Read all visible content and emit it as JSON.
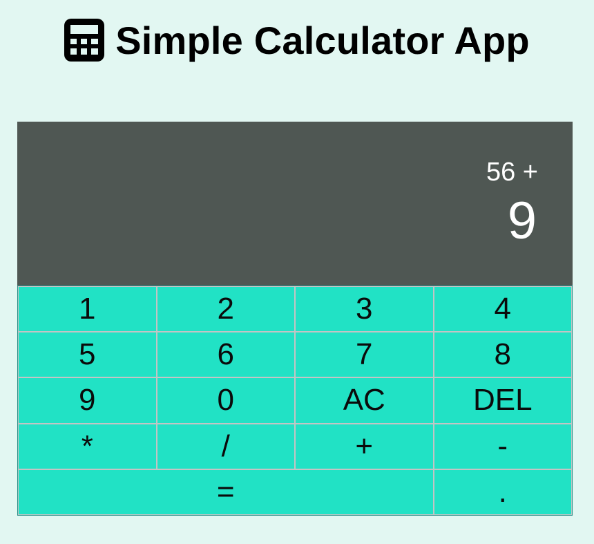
{
  "header": {
    "icon": "calculator-icon",
    "title": "Simple Calculator App"
  },
  "display": {
    "previous": "56 +",
    "current": "9"
  },
  "keypad": {
    "rows": [
      [
        "1",
        "2",
        "3",
        "4"
      ],
      [
        "5",
        "6",
        "7",
        "8"
      ],
      [
        "9",
        "0",
        "AC",
        "DEL"
      ],
      [
        "*",
        "/",
        "+",
        "-"
      ],
      [
        "=",
        "."
      ]
    ]
  },
  "colors": {
    "page_background": "#e2f7f2",
    "display_background": "#4f5753",
    "key_background": "#21e2c5",
    "key_border": "#c4c4c4",
    "display_text": "#ffffff"
  }
}
